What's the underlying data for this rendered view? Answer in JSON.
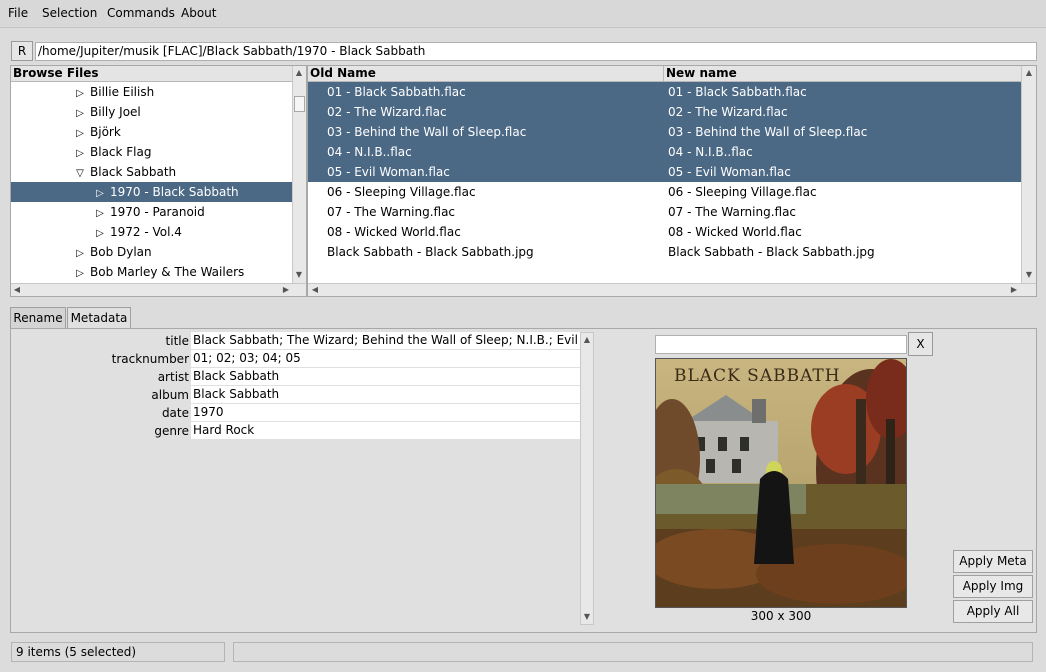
{
  "menu": [
    "File",
    "Selection",
    "Commands",
    "About"
  ],
  "pathbar": {
    "button_label": "R",
    "path": "/home/Jupiter/musik [FLAC]/Black Sabbath/1970 - Black Sabbath"
  },
  "browse": {
    "header": "Browse Files",
    "items": [
      {
        "label": "Billie Eilish",
        "expanded": false,
        "selected": false
      },
      {
        "label": "Billy Joel",
        "expanded": false,
        "selected": false
      },
      {
        "label": "Björk",
        "expanded": false,
        "selected": false
      },
      {
        "label": "Black Flag",
        "expanded": false,
        "selected": false
      },
      {
        "label": "Black Sabbath",
        "expanded": true,
        "selected": false
      },
      {
        "label": "1970 - Black Sabbath",
        "expanded": false,
        "selected": true
      },
      {
        "label": "1970 - Paranoid",
        "expanded": false,
        "selected": false
      },
      {
        "label": "1972 - Vol.4",
        "expanded": false,
        "selected": false
      },
      {
        "label": "Bob Dylan",
        "expanded": false,
        "selected": false
      },
      {
        "label": "Bob Marley & The Wailers",
        "expanded": false,
        "selected": false
      }
    ]
  },
  "files": {
    "col_old": "Old Name",
    "col_new": "New name",
    "rows": [
      {
        "old": "01 - Black Sabbath.flac",
        "new": "01 - Black Sabbath.flac",
        "selected": true
      },
      {
        "old": "02 - The Wizard.flac",
        "new": "02 - The Wizard.flac",
        "selected": true
      },
      {
        "old": "03 - Behind the Wall of Sleep.flac",
        "new": "03 - Behind the Wall of Sleep.flac",
        "selected": true
      },
      {
        "old": "04 - N.I.B..flac",
        "new": "04 - N.I.B..flac",
        "selected": true
      },
      {
        "old": "05 - Evil Woman.flac",
        "new": "05 - Evil Woman.flac",
        "selected": true
      },
      {
        "old": "06 - Sleeping Village.flac",
        "new": "06 - Sleeping Village.flac",
        "selected": false
      },
      {
        "old": "07 - The Warning.flac",
        "new": "07 - The Warning.flac",
        "selected": false
      },
      {
        "old": "08 - Wicked World.flac",
        "new": "08 - Wicked World.flac",
        "selected": false
      },
      {
        "old": "Black Sabbath -  Black Sabbath.jpg",
        "new": "Black Sabbath -  Black Sabbath.jpg",
        "selected": false
      }
    ]
  },
  "tabs": {
    "rename": "Rename",
    "metadata": "Metadata"
  },
  "metadata": [
    {
      "label": "title",
      "value": "Black Sabbath; The Wizard; Behind the Wall of Sleep; N.I.B.; Evil Woman"
    },
    {
      "label": "tracknumber",
      "value": "01; 02; 03; 04; 05"
    },
    {
      "label": "artist",
      "value": "Black Sabbath"
    },
    {
      "label": "album",
      "value": "Black Sabbath"
    },
    {
      "label": "date",
      "value": "1970"
    },
    {
      "label": "genre",
      "value": "Hard Rock"
    }
  ],
  "image": {
    "url_value": "",
    "clear_label": "X",
    "size_label": "300 x 300",
    "cover_text": "BLACK SABBATH"
  },
  "actions": {
    "apply_meta": "Apply Meta",
    "apply_img": "Apply Img",
    "apply_all": "Apply All"
  },
  "status": {
    "text": "9 items (5 selected)",
    "right": ""
  },
  "colors": {
    "selection": "#4b6885",
    "background": "#dcdcdc"
  }
}
